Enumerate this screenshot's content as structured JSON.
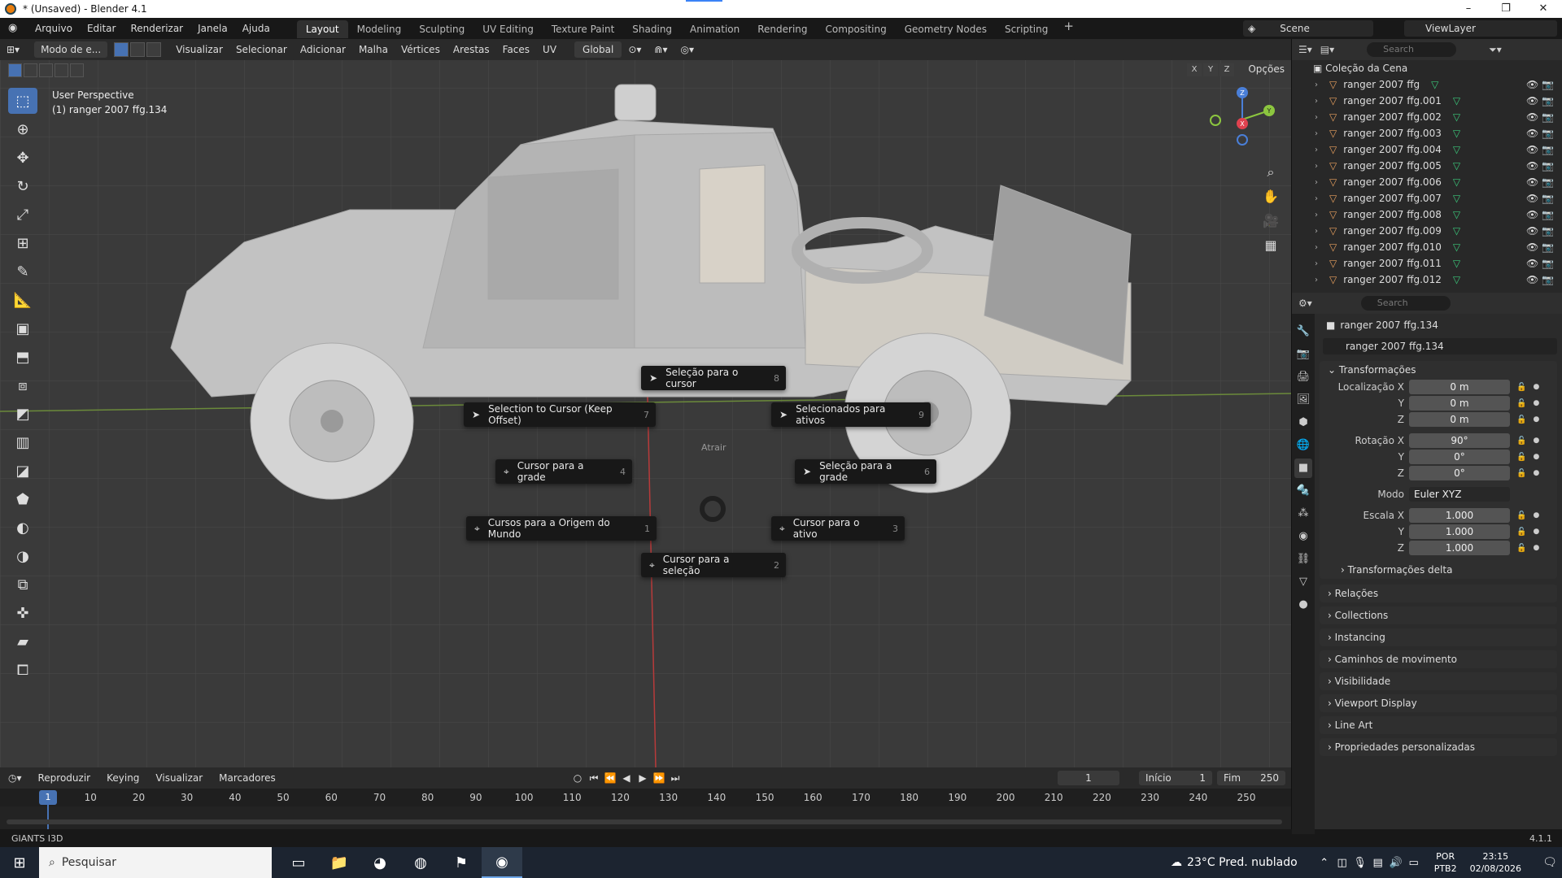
{
  "window": {
    "title": "* (Unsaved) - Blender 4.1",
    "min": "–",
    "max": "❐",
    "close": "✕"
  },
  "menu": [
    "Arquivo",
    "Editar",
    "Renderizar",
    "Janela",
    "Ajuda"
  ],
  "workspaces": [
    "Layout",
    "Modeling",
    "Sculpting",
    "UV Editing",
    "Texture Paint",
    "Shading",
    "Animation",
    "Rendering",
    "Compositing",
    "Geometry Nodes",
    "Scripting"
  ],
  "scene": "Scene",
  "view_layer": "ViewLayer",
  "viewport": {
    "mode": "Modo de e...",
    "menu": [
      "Visualizar",
      "Selecionar",
      "Adicionar",
      "Malha",
      "Vértices",
      "Arestas",
      "Faces",
      "UV"
    ],
    "orientation": "Global",
    "perspective": "User Perspective",
    "object_info": "(1) ranger 2007 ffg.134",
    "options": "Opções",
    "axis_x": "X",
    "axis_y": "Y",
    "axis_z": "Z"
  },
  "pie_menu": {
    "title": "Atrair",
    "items": [
      {
        "label": "Seleção para o cursor",
        "key": "8"
      },
      {
        "label": "Selection to Cursor (Keep Offset)",
        "key": "7"
      },
      {
        "label": "Selecionados para ativos",
        "key": "9"
      },
      {
        "label": "Cursor para a grade",
        "key": "4"
      },
      {
        "label": "Seleção para a grade",
        "key": "6"
      },
      {
        "label": "Cursos para a Origem do Mundo",
        "key": "1"
      },
      {
        "label": "Cursor para o ativo",
        "key": "3"
      },
      {
        "label": "Cursor para a seleção",
        "key": "2"
      }
    ]
  },
  "timeline": {
    "menu": [
      "Reproduzir",
      "Keying",
      "Visualizar",
      "Marcadores"
    ],
    "current_frame": "1",
    "start_label": "Início",
    "start": "1",
    "end_label": "Fim",
    "end": "250",
    "ticks": [
      "10",
      "20",
      "30",
      "40",
      "50",
      "60",
      "70",
      "80",
      "90",
      "100",
      "110",
      "120",
      "130",
      "140",
      "150",
      "160",
      "170",
      "180",
      "190",
      "200",
      "210",
      "220",
      "230",
      "240",
      "250"
    ],
    "playhead": "1"
  },
  "status": {
    "left": "GIANTS I3D",
    "version": "4.1.1"
  },
  "outliner": {
    "search": "Search",
    "collection": "Coleção da Cena",
    "objects": [
      "ranger 2007 ffg",
      "ranger 2007 ffg.001",
      "ranger 2007 ffg.002",
      "ranger 2007 ffg.003",
      "ranger 2007 ffg.004",
      "ranger 2007 ffg.005",
      "ranger 2007 ffg.006",
      "ranger 2007 ffg.007",
      "ranger 2007 ffg.008",
      "ranger 2007 ffg.009",
      "ranger 2007 ffg.010",
      "ranger 2007 ffg.011",
      "ranger 2007 ffg.012"
    ]
  },
  "properties": {
    "search": "Search",
    "object_name": "ranger 2007 ffg.134",
    "transform_title": "Transformações",
    "location": {
      "label": "Localização X",
      "x": "0 m",
      "y": "0 m",
      "z": "0 m"
    },
    "rotation": {
      "label": "Rotação X",
      "x": "90°",
      "y": "0°",
      "z": "0°"
    },
    "mode": {
      "label": "Modo",
      "value": "Euler XYZ"
    },
    "scale": {
      "label": "Escala X",
      "x": "1.000",
      "y": "1.000",
      "z": "1.000"
    },
    "y_label": "Y",
    "z_label": "Z",
    "delta": "Transformações delta",
    "panels": [
      "Relações",
      "Collections",
      "Instancing",
      "Caminhos de movimento",
      "Visibilidade",
      "Viewport Display",
      "Line Art",
      "Propriedades personalizadas"
    ]
  },
  "taskbar": {
    "search": "Pesquisar",
    "weather": "23°C Pred. nublado",
    "lang1": "POR",
    "lang2": "PTB2",
    "time": "23:15",
    "date": "02/08/2026"
  }
}
